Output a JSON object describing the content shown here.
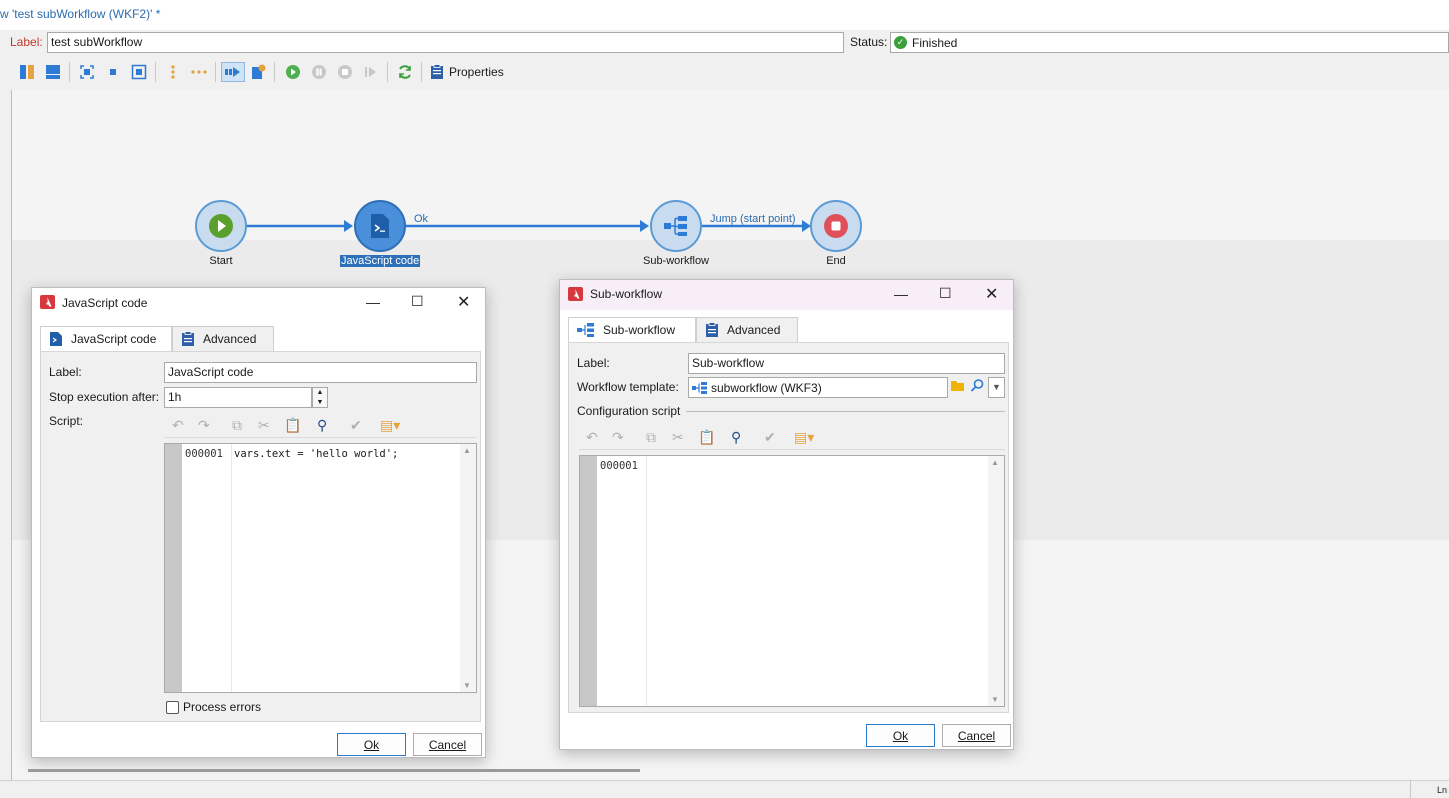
{
  "window": {
    "title": "w 'test subWorkflow (WKF2)' *"
  },
  "header": {
    "label_caption": "Label:",
    "label_value": "test subWorkflow",
    "status_caption": "Status:",
    "status_value": "Finished"
  },
  "toolbar": {
    "properties_label": "Properties"
  },
  "workflow": {
    "nodes": [
      {
        "label": "Start"
      },
      {
        "label": "JavaScript code"
      },
      {
        "label": "Sub-workflow"
      },
      {
        "label": "End"
      }
    ],
    "edges": [
      {
        "label": "Ok"
      },
      {
        "label": "Jump (start point)"
      }
    ]
  },
  "js_dialog": {
    "title": "JavaScript code",
    "tabs": [
      {
        "label": "JavaScript code"
      },
      {
        "label": "Advanced"
      }
    ],
    "label_caption": "Label:",
    "label_value": "JavaScript code",
    "stop_caption": "Stop execution after:",
    "stop_value": "1h",
    "script_caption": "Script:",
    "line_no": "000001",
    "code_line": "vars.text = 'hello world';",
    "process_errors": "Process errors",
    "ok": "Ok",
    "cancel": "Cancel"
  },
  "sub_dialog": {
    "title": "Sub-workflow",
    "tabs": [
      {
        "label": "Sub-workflow"
      },
      {
        "label": "Advanced"
      }
    ],
    "label_caption": "Label:",
    "label_value": "Sub-workflow",
    "template_caption": "Workflow template:",
    "template_value": "subworkflow (WKF3)",
    "config_caption": "Configuration script",
    "line_no": "000001",
    "ok": "Ok",
    "cancel": "Cancel"
  },
  "statusbar": {
    "text": "Ln"
  },
  "colors": {
    "accent": "#2e7bd6",
    "status_green": "#3aa03a",
    "title_red": "#c0392b"
  }
}
